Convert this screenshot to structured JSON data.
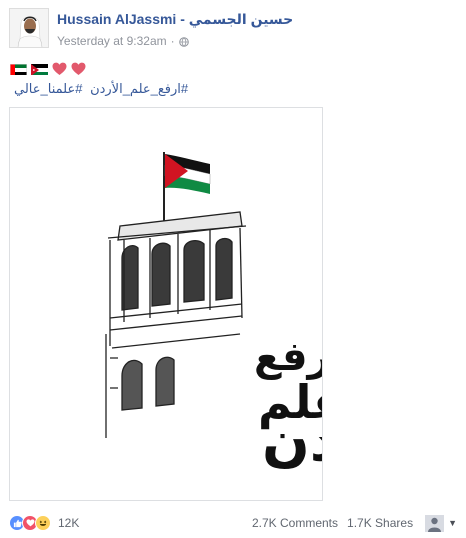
{
  "post": {
    "author": "Hussain AlJassmi - حسين الجسمي",
    "timestamp": "Yesterday at 9:32am",
    "separator": "·",
    "privacy_icon": "globe-icon",
    "emoji_line": [
      "uae-flag-icon",
      "jordan-flag-icon",
      "heart-icon",
      "heart-icon"
    ],
    "hashtags": [
      "#ارفع_علم_الأردن",
      "#علمنا_عالي"
    ],
    "image": {
      "description_icon": "jordan-flag-tower-illustration",
      "calligraphy": [
        "إرفع",
        "علم",
        "الأردن"
      ]
    }
  },
  "footer": {
    "reactions": [
      "like-icon",
      "love-icon",
      "haha-icon"
    ],
    "reaction_count": "12K",
    "comments": "2.7K Comments",
    "shares": "1.7K Shares"
  },
  "colors": {
    "link": "#365899",
    "meta": "#90949c",
    "like": "#5890ff",
    "love": "#f25268",
    "haha": "#fcd05a"
  }
}
